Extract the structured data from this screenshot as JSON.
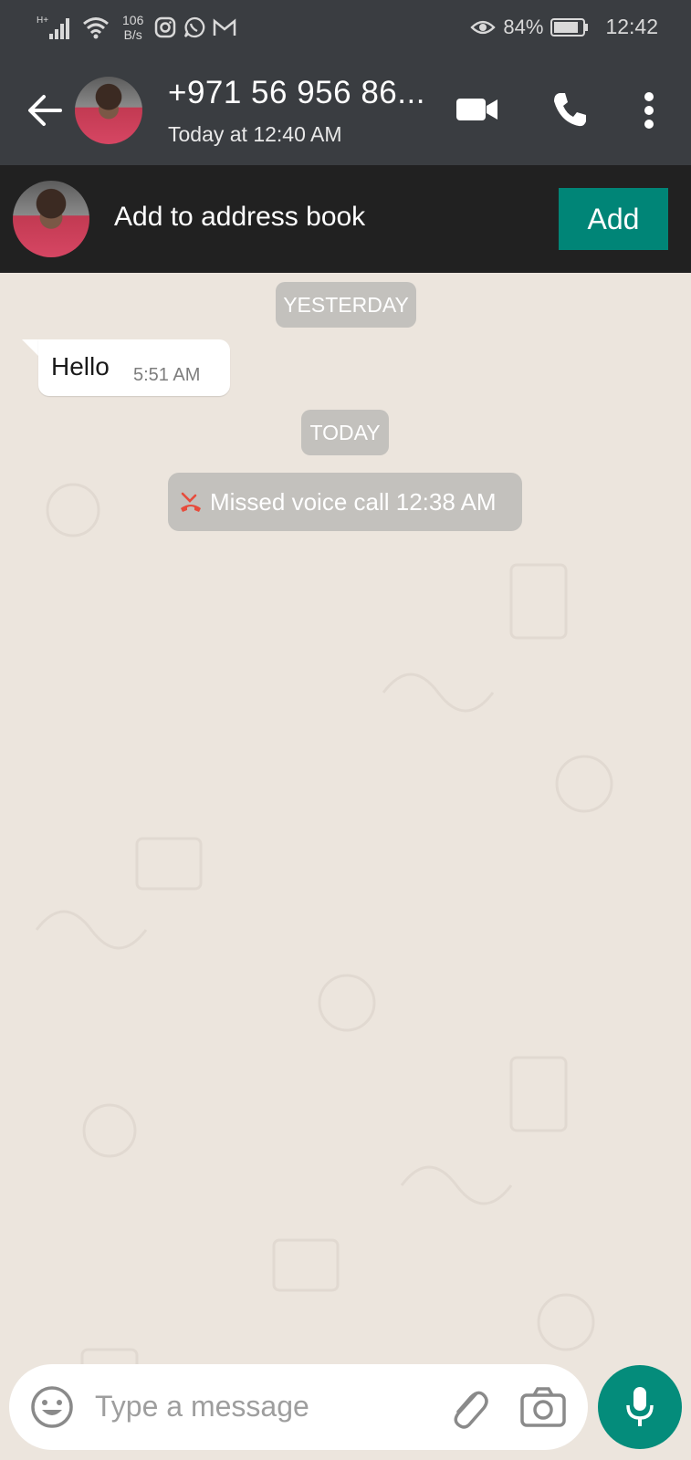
{
  "status_bar": {
    "network_speed_value": "106",
    "network_speed_unit": "B/s",
    "battery": "84%",
    "time": "12:42"
  },
  "header": {
    "contact_name": "+971 56 956 86...",
    "last_seen": "Today at 12:40 AM"
  },
  "banner": {
    "text": "Add to address book",
    "add_label": "Add"
  },
  "chat": {
    "date_yesterday": "YESTERDAY",
    "message_text": "Hello",
    "message_time": "5:51 AM",
    "date_today": "TODAY",
    "missed_call": "Missed voice call 12:38 AM"
  },
  "composer": {
    "placeholder": "Type a message"
  },
  "colors": {
    "header": "#3a3d41",
    "banner": "#212121",
    "accent": "#008577",
    "chat_bg": "#ece5dd",
    "missed_red": "#e74c3c"
  }
}
